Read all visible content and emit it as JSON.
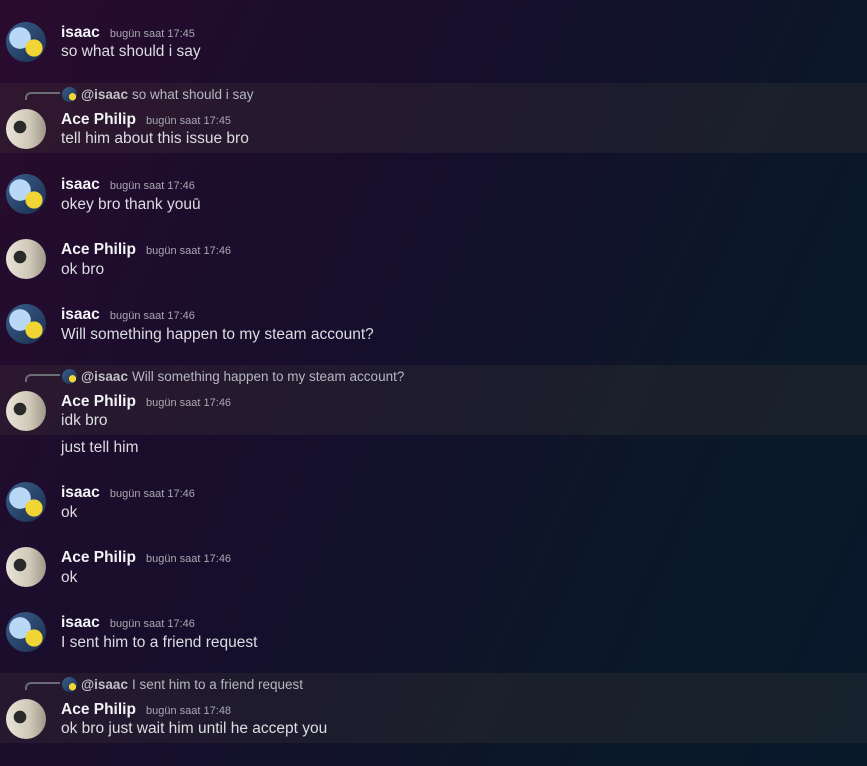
{
  "messages": [
    {
      "author": "isaac",
      "time": "bugün saat 17:45",
      "text": "so what should i say"
    },
    {
      "reply": {
        "mention": "@isaac",
        "text": "so what should i say"
      },
      "author": "Ace Philip",
      "time": "bugün saat 17:45",
      "text": "tell him about this issue bro"
    },
    {
      "author": "isaac",
      "time": "bugün saat 17:46",
      "text": "okey bro thank youū"
    },
    {
      "author": "Ace Philip",
      "time": "bugün saat 17:46",
      "text": "ok bro"
    },
    {
      "author": "isaac",
      "time": "bugün saat 17:46",
      "text": "Will something happen to my steam account?"
    },
    {
      "reply": {
        "mention": "@isaac",
        "text": "Will something happen to my steam account?"
      },
      "author": "Ace Philip",
      "time": "bugün saat 17:46",
      "text": "idk bro",
      "followup": "just tell him"
    },
    {
      "author": "isaac",
      "time": "bugün saat 17:46",
      "text": "ok"
    },
    {
      "author": "Ace Philip",
      "time": "bugün saat 17:46",
      "text": "ok"
    },
    {
      "author": "isaac",
      "time": "bugün saat 17:46",
      "text": "I sent him to a friend request"
    },
    {
      "reply": {
        "mention": "@isaac",
        "text": "I sent him to a friend request"
      },
      "author": "Ace Philip",
      "time": "bugün saat 17:48",
      "text": "ok bro just wait him until he accept you"
    }
  ],
  "icons": {
    "isaac_avatar": "avatar-isaac-icon",
    "ace_avatar": "avatar-ace-icon",
    "reply_spine": "reply-spine-icon"
  }
}
